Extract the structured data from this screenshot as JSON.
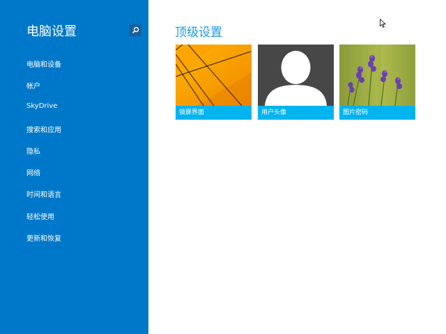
{
  "sidebar": {
    "title": "电脑设置",
    "search_icon": "search-icon",
    "items": [
      {
        "label": "电脑和设备"
      },
      {
        "label": "帐户"
      },
      {
        "label": "SkyDrive"
      },
      {
        "label": "搜索和应用"
      },
      {
        "label": "隐私"
      },
      {
        "label": "网络"
      },
      {
        "label": "时间和语言"
      },
      {
        "label": "轻松使用"
      },
      {
        "label": "更新和恢复"
      }
    ]
  },
  "main": {
    "title": "顶级设置",
    "tiles": [
      {
        "label": "锁屏界面"
      },
      {
        "label": "用户头像"
      },
      {
        "label": "图片密码"
      }
    ]
  },
  "colors": {
    "sidebar_bg": "#0078c9",
    "accent_title": "#1a9ae0",
    "tile_label_bg": "#00b4f0"
  }
}
